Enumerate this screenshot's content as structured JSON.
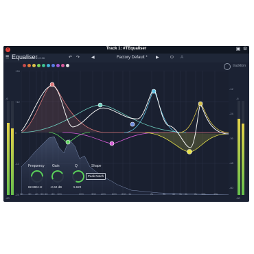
{
  "window": {
    "title": "Track 1: #TEqualiser"
  },
  "plugin": {
    "name": "Equaliser",
    "version": "v1.0.26",
    "preset": "Factory Default *",
    "logo": "tracktion",
    "ab_label": "A"
  },
  "band_colors": [
    "#c44b4b",
    "#e07a3a",
    "#d9c04a",
    "#7bd25a",
    "#3fbf8f",
    "#3fb0d6",
    "#5a7be0",
    "#a45ad6",
    "#d65a9a",
    "#e0e0e0"
  ],
  "y_axis_left": [
    "+24",
    "+12",
    "0",
    "-12",
    "-24"
  ],
  "y_axis_right": [
    "-12",
    "-24",
    "-36",
    "-48",
    "-60"
  ],
  "x_axis": [
    "20",
    "30",
    "40",
    "50",
    "60",
    "80",
    "100",
    "200",
    "300",
    "400",
    "600",
    "800",
    "1k",
    "2k",
    "3k",
    "4k",
    "5k",
    "6k",
    "8k",
    "10k",
    "15k"
  ],
  "meter_labels": {
    "left_top": "-6",
    "left_bottom": "-60",
    "right_top": "-6",
    "right_bottom": "-60"
  },
  "controls": {
    "frequency": {
      "label": "Frequency",
      "value": "82.896 Hz"
    },
    "gain": {
      "label": "Gain",
      "value": "-2.62 dB"
    },
    "q": {
      "label": "Q",
      "value": "5.620"
    },
    "shape": {
      "label": "Shape",
      "value": "Peak Notch"
    }
  },
  "bands": [
    {
      "color": "#e0787a",
      "fill": "#d77a7c"
    },
    {
      "color": "#5bd15a",
      "fill": "#5bd15a"
    },
    {
      "color": "#6fd1c1",
      "fill": "#6fd1c1"
    },
    {
      "color": "#d65ad6",
      "fill": "#d65ad6"
    },
    {
      "color": "#6f8de0",
      "fill": "#6f8de0"
    },
    {
      "color": "#5fc0e0",
      "fill": "#5fc0e0"
    },
    {
      "color": "#e7e24a",
      "fill": "#e7e24a"
    },
    {
      "color": "#d8c34a",
      "fill": "#d8c34a"
    }
  ]
}
